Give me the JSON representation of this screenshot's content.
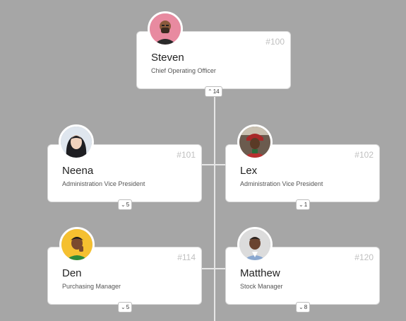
{
  "nodes": [
    {
      "id": "#100",
      "name": "Steven",
      "title": "Chief Operating Officer",
      "count": "14",
      "expanded": true,
      "avatar_bg": "#e88aa0"
    },
    {
      "id": "#101",
      "name": "Neena",
      "title": "Administration Vice President",
      "count": "5",
      "expanded": false,
      "avatar_bg": "#dfe6ee"
    },
    {
      "id": "#102",
      "name": "Lex",
      "title": "Administration Vice President",
      "count": "1",
      "expanded": false,
      "avatar_bg": "#6b5b4e"
    },
    {
      "id": "#114",
      "name": "Den",
      "title": "Purchasing Manager",
      "count": "5",
      "expanded": false,
      "avatar_bg": "#f5c030"
    },
    {
      "id": "#120",
      "name": "Matthew",
      "title": "Stock Manager",
      "count": "8",
      "expanded": false,
      "avatar_bg": "#dcdcdc"
    }
  ],
  "colors": {
    "background": "#a6a6a6",
    "card": "#ffffff",
    "connector": "#e6e6e6"
  },
  "icons": {
    "expand": "chevron-down-icon",
    "collapse": "chevron-up-icon"
  }
}
